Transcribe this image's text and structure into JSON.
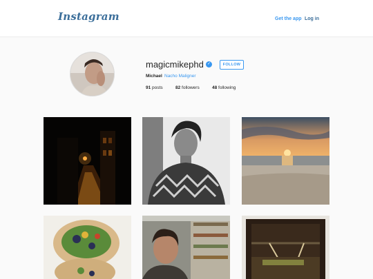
{
  "header": {
    "logo": "Instagram",
    "get_app": "Get the app",
    "login": "Log in"
  },
  "profile": {
    "username": "magicmikephd",
    "verified_icon": "verified-badge-icon",
    "follow_label": "FOLLOW",
    "full_name": "Michael",
    "bio_link": "Nacho Maligner",
    "stats": {
      "posts_count": "91",
      "posts_label": "posts",
      "followers_count": "82",
      "followers_label": "followers",
      "following_count": "48",
      "following_label": "following"
    }
  },
  "colors": {
    "accent": "#3897f0",
    "logo": "#3b6e9a",
    "background": "#fafafa"
  },
  "photos": [
    "night-alley-photo",
    "man-patterned-sweater-photo",
    "beach-sunset-photo",
    "veggie-wrap-photo",
    "man-in-store-aisle-photo",
    "greenhouse-interior-photo"
  ]
}
